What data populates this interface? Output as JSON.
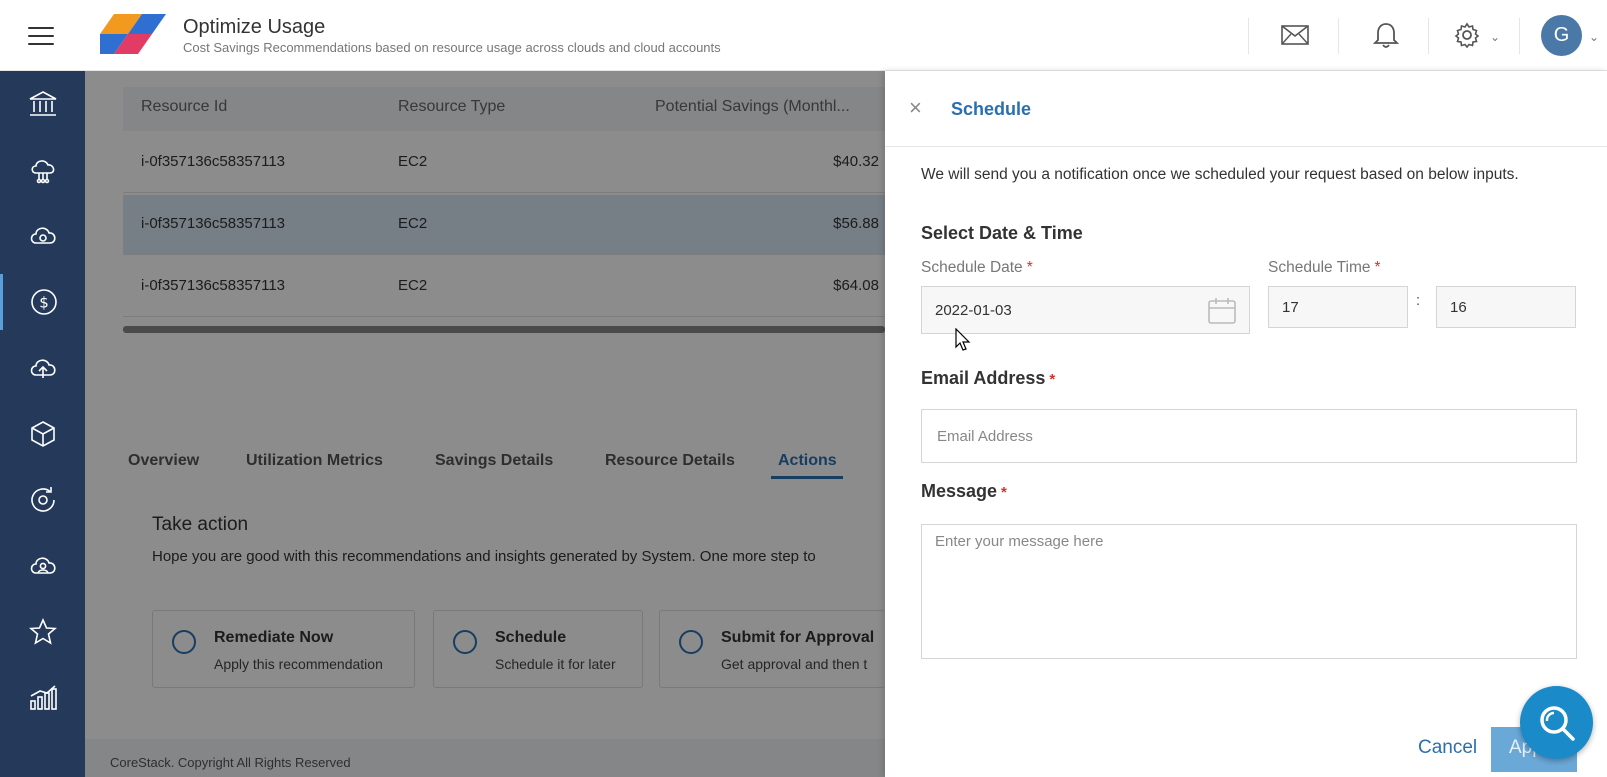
{
  "header": {
    "title": "Optimize Usage",
    "subtitle": "Cost Savings Recommendations based on resource usage across clouds and cloud accounts",
    "avatar_initial": "G",
    "icons": [
      "hamburger-icon",
      "mail-icon",
      "bell-icon",
      "gear-icon",
      "chevron-down-icon"
    ]
  },
  "sidebar": {
    "items": [
      "bank-icon",
      "cloud-network-icon",
      "cloud-gear-icon",
      "dollar-icon",
      "cloud-upload-icon",
      "cube-icon",
      "refresh-gear-icon",
      "cloud-user-icon",
      "star-icon",
      "bar-chart-icon"
    ],
    "active_index": 3
  },
  "table": {
    "columns": [
      "Resource Id",
      "Resource Type",
      "Potential Savings (Monthl..."
    ],
    "rows": [
      {
        "id": "i-0f357136c58357113",
        "type": "EC2",
        "savings": "$40.32"
      },
      {
        "id": "i-0f357136c58357113",
        "type": "EC2",
        "savings": "$56.88"
      },
      {
        "id": "i-0f357136c58357113",
        "type": "EC2",
        "savings": "$64.08"
      }
    ],
    "selected_row": 1
  },
  "tabs": [
    "Overview",
    "Utilization Metrics",
    "Savings Details",
    "Resource Details",
    "Actions"
  ],
  "active_tab": "Actions",
  "take_action": {
    "title": "Take action",
    "description": "Hope you are good with this recommendations and insights generated by System. One more step to",
    "options": [
      {
        "title": "Remediate Now",
        "subtitle": "Apply this recommendation"
      },
      {
        "title": "Schedule",
        "subtitle": "Schedule it for later"
      },
      {
        "title": "Submit for Approval",
        "subtitle": "Get approval and then t"
      }
    ]
  },
  "footer": {
    "copyright": "CoreStack. Copyright All Rights Reserved"
  },
  "drawer": {
    "title": "Schedule",
    "close_symbol": "×",
    "notice": "We will send you a notification once we scheduled your request based on below inputs.",
    "section_title": "Select Date & Time",
    "schedule_date": {
      "label": "Schedule Date",
      "value": "2022-01-03"
    },
    "schedule_time": {
      "label": "Schedule Time",
      "hour": "17",
      "minute": "16",
      "separator": ":"
    },
    "email": {
      "label": "Email Address",
      "placeholder": "Email Address",
      "value": ""
    },
    "message": {
      "label": "Message",
      "placeholder": "Enter your message here",
      "value": ""
    },
    "required_marker": "*",
    "cancel_label": "Cancel",
    "apply_label": "App"
  },
  "colors": {
    "sidebar": "#253a5b",
    "accent": "#2a6fb0",
    "selected_row": "#d8e8f5",
    "search_fab": "#1a8ac9",
    "required": "#d9302a"
  }
}
